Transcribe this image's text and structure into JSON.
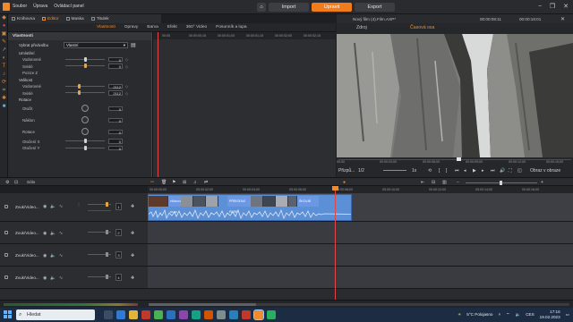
{
  "menu": [
    "Soubor",
    "Úprava",
    "Ovládací panel"
  ],
  "top_buttons": {
    "import": "Import",
    "edit": "Upravit",
    "export": "Export"
  },
  "window_controls": [
    "−",
    "❐",
    "✕"
  ],
  "library_tabs": [
    {
      "label": "Knihovna"
    },
    {
      "label": "Editor",
      "active": true
    },
    {
      "label": "Maska"
    },
    {
      "label": "Titulek"
    }
  ],
  "editor_tabs": [
    {
      "label": "Vlastnosti",
      "active": true
    },
    {
      "label": "Opravy"
    },
    {
      "label": "Barva"
    },
    {
      "label": "Efekt"
    },
    {
      "label": "360° Video"
    },
    {
      "label": "Posunník a lupa"
    }
  ],
  "properties": {
    "section_title": "Vlastnosti",
    "preset_label": "Vybrat předvolbu",
    "preset_value": "Vlastní",
    "group_umisteni": "Umístění",
    "vodorovne": {
      "label": "Vodorovné",
      "value": "0",
      "level": 0.5
    },
    "svisle": {
      "label": "Svislé",
      "value": "0",
      "level": 0.5
    },
    "pozice_z": {
      "label": "Pozice Z"
    },
    "group_velikost": "Velikost",
    "vel_vodorovne": {
      "label": "Vodorovné",
      "value": "2112"
    },
    "vel_svisle": {
      "label": "Svislé",
      "value": "2112"
    },
    "group_rotace": "Rotace",
    "otocit": {
      "label": "Otočit",
      "value": "0"
    },
    "naklon": {
      "label": "Náklon",
      "value": "0"
    },
    "rotace": {
      "label": "Rotace",
      "value": "0"
    },
    "otoceni_x": {
      "label": "Otočení X",
      "value": "0"
    },
    "otoceni_y": {
      "label": "Otočení Y",
      "value": "0"
    }
  },
  "mini_ruler_ticks": [
    "00:00",
    "00:00:00;15",
    "00:00:01;00",
    "00:00:01;15",
    "00:00:02;00",
    "00:00:02;15"
  ],
  "preview": {
    "title": "Nový film (4).Film.AXP*",
    "tab_source": "Zdroj",
    "tab_timeline": "Časová osa",
    "timecode": "00:00:08:11",
    "duration": "00:00:16:01",
    "timecode_labels": [
      "00:00",
      "00:00:03;00",
      "00:00:06;00",
      "00:00:09;00",
      "00:00:12;00",
      "00:00:15;00"
    ],
    "fit_label": "Přizpů...",
    "ratio": "1/2",
    "speed": "1x",
    "view_label": "Obraz v obraze"
  },
  "timeline": {
    "toolbar_label": "Sólo",
    "ruler_ticks": [
      "00:00:00;00",
      "00:00:02;00",
      "00:00:04;00",
      "00:00:06;00",
      "00:00:08;00",
      "00:00:10;00",
      "00:00:12;00",
      "00:00:14;00",
      "00:00:16;00",
      "00:00:18;00"
    ],
    "tracks": [
      {
        "name": "Zvuk/Video...",
        "num": "1"
      },
      {
        "name": "Zvuk/Video...",
        "num": "2"
      },
      {
        "name": "Zvuk/Video...",
        "num": "3"
      },
      {
        "name": "Zvuk/Video...",
        "num": "4"
      }
    ],
    "clip_titles": [
      "PŘÍRODNÍ PARK",
      "PŘÍRODNÍ PARK",
      "ŠKOLNÍ"
    ]
  },
  "taskbar": {
    "search_placeholder": "Hledat",
    "weather": "5°C Polojasno",
    "language": "CES",
    "time": "17:16",
    "date": "19.02.2023"
  },
  "colors": {
    "accent": "#f07c1c",
    "clip": "#5b8fd6",
    "playhead": "#e04848"
  }
}
